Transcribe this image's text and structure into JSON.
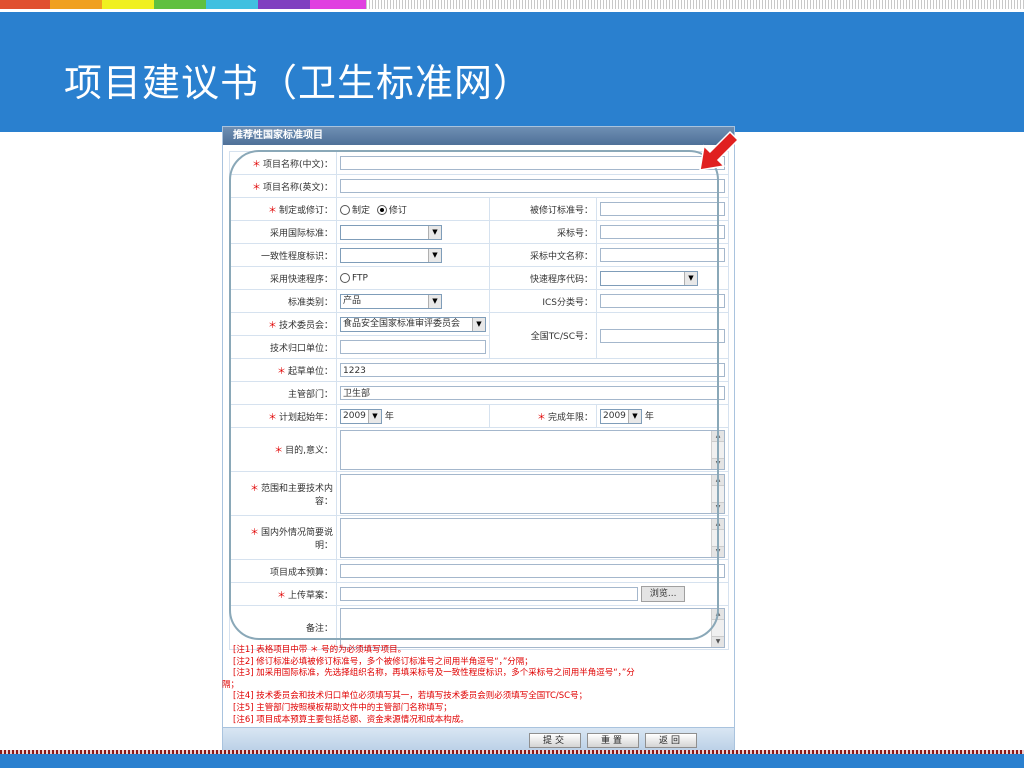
{
  "slide": {
    "title": "项目建议书（卫生标准网）"
  },
  "colors": {
    "band": "#2a80cf",
    "strip": [
      "#e05030",
      "#f0a020",
      "#f0f020",
      "#60c040",
      "#40c0e0",
      "#8040c0",
      "#e040e0"
    ]
  },
  "panel": {
    "title": "推荐性国家标准项目"
  },
  "form": {
    "name_cn_label": "项目名称(中文)：",
    "name_en_label": "项目名称(英文)：",
    "type_label": "制定或修订：",
    "type_opt1": "制定",
    "type_opt2": "修订",
    "revised_no_label": "被修订标准号：",
    "intl_label": "采用国际标准：",
    "adopt_no_label": "采标号：",
    "consistency_label": "一致性程度标识：",
    "adopt_cn_label": "采标中文名称：",
    "fast_label": "采用快速程序：",
    "fast_opt": "FTP",
    "fast_code_label": "快速程序代码：",
    "category_label": "标准类别：",
    "category_value": "产品",
    "ics_label": "ICS分类号：",
    "committee_label": "技术委员会：",
    "committee_value": "食品安全国家标准审评委员会",
    "tc_label": "全国TC/SC号：",
    "unit_label": "技术归口单位：",
    "draft_label": "起草单位：",
    "draft_value": "1223",
    "dept_label": "主管部门：",
    "dept_value": "卫生部",
    "start_label": "计划起始年：",
    "start_value": "2009",
    "year_unit": "年",
    "end_label": "完成年限：",
    "end_value": "2009",
    "purpose_label": "目的,意义：",
    "scope_label": "范围和主要技术内容：",
    "status_label": "国内外情况简要说明：",
    "budget_label": "项目成本预算：",
    "upload_label": "上传草案：",
    "browse_label": "浏览...",
    "remark_label": "备注："
  },
  "notes": [
    "[注1] 表格项目中带 ＊ 号的为必须填写项目。",
    "[注2] 修订标准必填被修订标准号，多个被修订标准号之间用半角逗号“，”分隔；",
    "[注3] 加采用国际标准，先选择组织名称，再填采标号及一致性程度标识，多个采标号之间用半角逗号“，”分",
    "隔；",
    "[注4] 技术委员会和技术归口单位必须填写其一，若填写技术委员会则必须填写全国TC/SC号；",
    "[注5] 主管部门按照模板帮助文件中的主管部门名称填写；",
    "[注6] 项目成本预算主要包括总额、资金来源情况和成本构成。"
  ],
  "buttons": {
    "submit": "提交",
    "reset": "重置",
    "back": "返回"
  }
}
